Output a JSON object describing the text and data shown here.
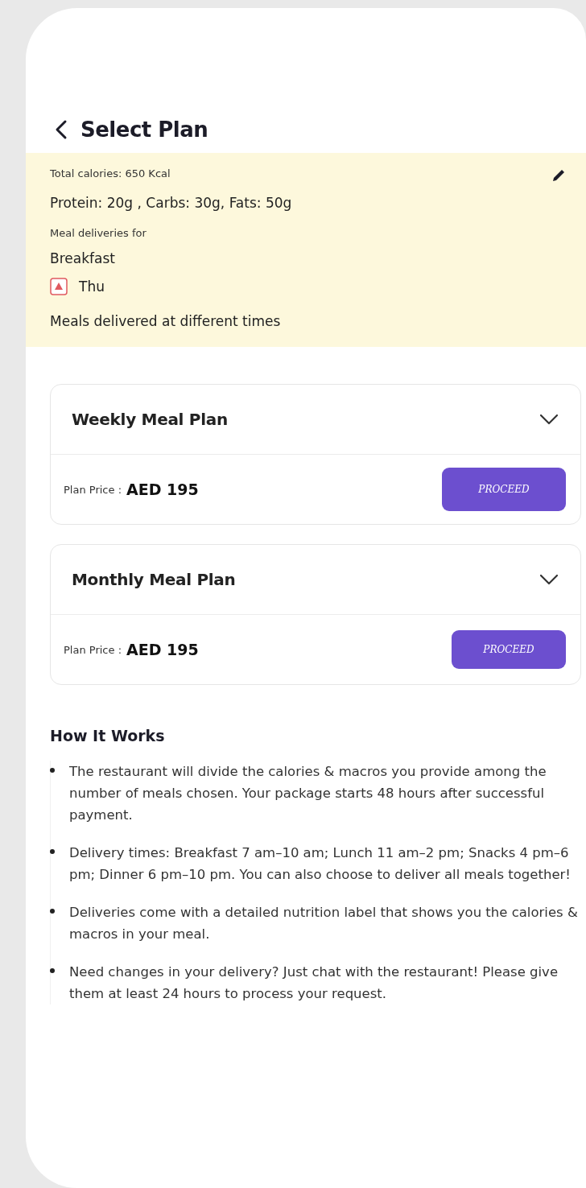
{
  "header": {
    "title": "Select Plan"
  },
  "summary": {
    "calories": "Total calories: 650 Kcal",
    "macros": "Protein:  20g , Carbs: 30g, Fats: 50g",
    "deliveries_label": "Meal deliveries for",
    "meal": "Breakfast",
    "day": "Thu",
    "note": "Meals delivered at different times"
  },
  "plans": [
    {
      "title": "Weekly Meal Plan",
      "expanded": false,
      "price_label": "Plan Price :",
      "price": "AED 195",
      "button": "PROCEED"
    },
    {
      "title": "Monthly Meal Plan",
      "expanded": false,
      "price_label": "Plan Price :",
      "price": "AED 195",
      "button": "PROCEED"
    }
  ],
  "how_it_works": {
    "title": "How It Works",
    "items": [
      "The restaurant will divide the calories & macros you provide among the number of meals chosen. Your package starts 48 hours after successful payment.",
      "Delivery times: Breakfast 7 am–10 am; Lunch 11 am–2 pm; Snacks 4 pm–6 pm; Dinner 6 pm–10 pm. You can also choose to deliver all meals together!",
      "Deliveries come with a detailed nutrition label that shows you the calories & macros in your meal.",
      "Need changes in your delivery? Just chat with the restaurant! Please give them at least 24 hours to process your request."
    ]
  }
}
